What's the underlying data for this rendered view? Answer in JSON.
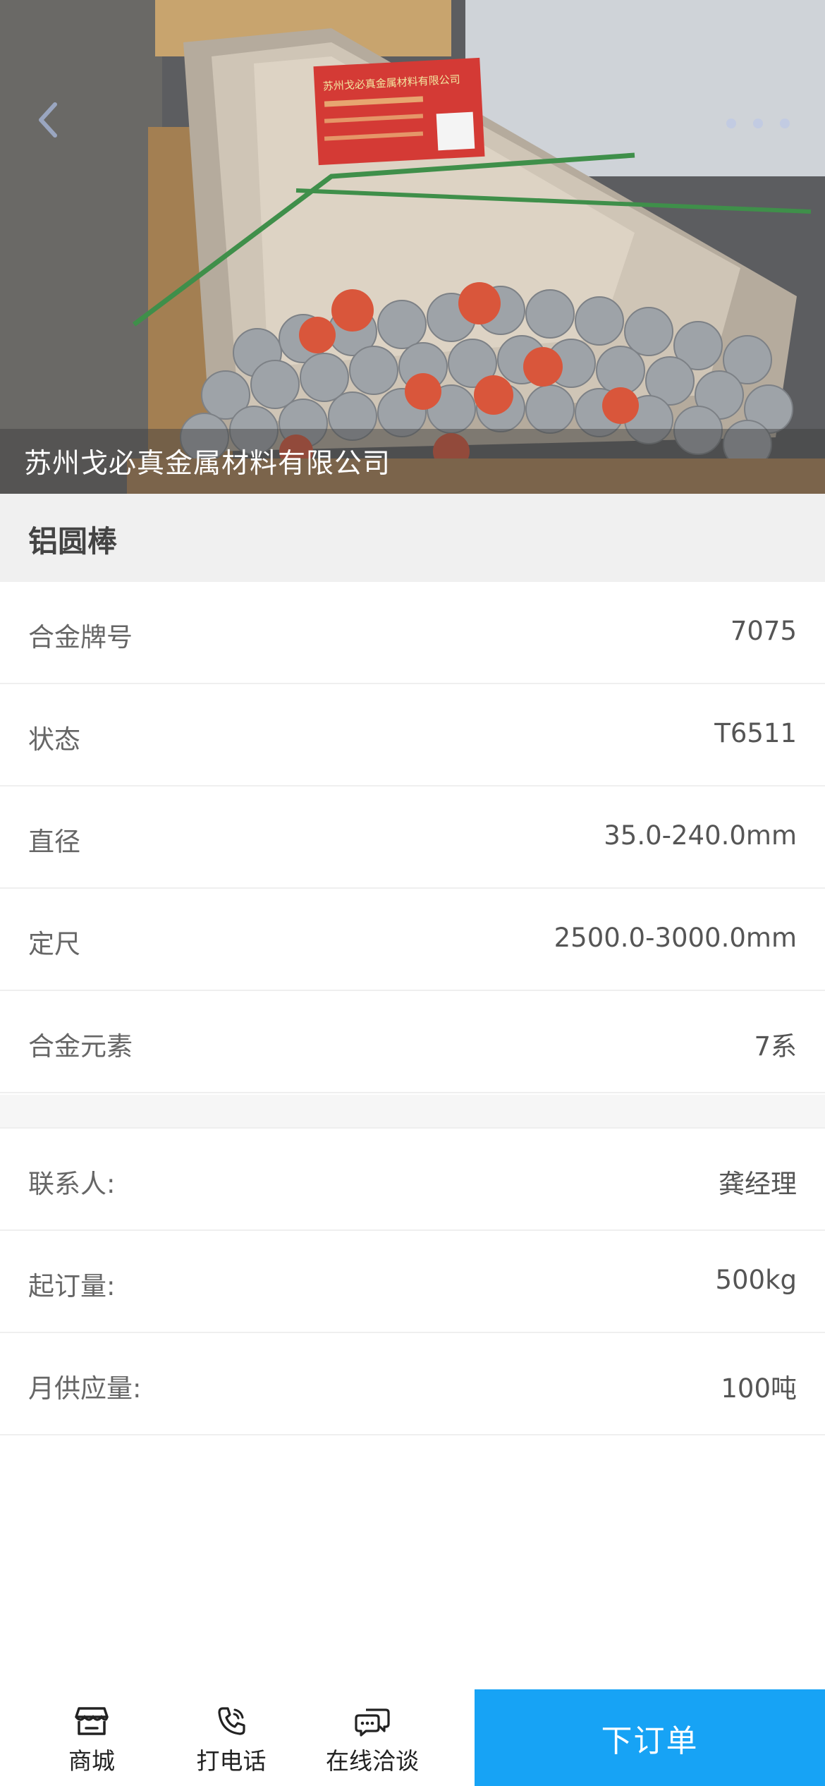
{
  "hero": {
    "company_name": "苏州戈必真金属材料有限公司",
    "sign_text": "苏州戈必真金属材料有限公司"
  },
  "product": {
    "title": "铝圆棒"
  },
  "specs": [
    {
      "label": "合金牌号",
      "value": "7075"
    },
    {
      "label": "状态",
      "value": "T6511"
    },
    {
      "label": "直径",
      "value": "35.0-240.0mm"
    },
    {
      "label": "定尺",
      "value": "2500.0-3000.0mm"
    },
    {
      "label": "合金元素",
      "value": "7系"
    }
  ],
  "contact": [
    {
      "label": "联系人:",
      "value": "龚经理"
    },
    {
      "label": "起订量:",
      "value": "500kg"
    },
    {
      "label": "月供应量:",
      "value": "100吨"
    }
  ],
  "bottom_bar": {
    "shop_label": "商城",
    "call_label": "打电话",
    "chat_label": "在线洽谈",
    "order_label": "下订单"
  },
  "icons": {
    "back": "chevron-left-icon",
    "more": "more-dots-icon",
    "shop": "store-icon",
    "call": "phone-icon",
    "chat": "chat-bubble-icon"
  },
  "colors": {
    "accent": "#17a3f5",
    "title_bg": "#f0f0f0"
  }
}
